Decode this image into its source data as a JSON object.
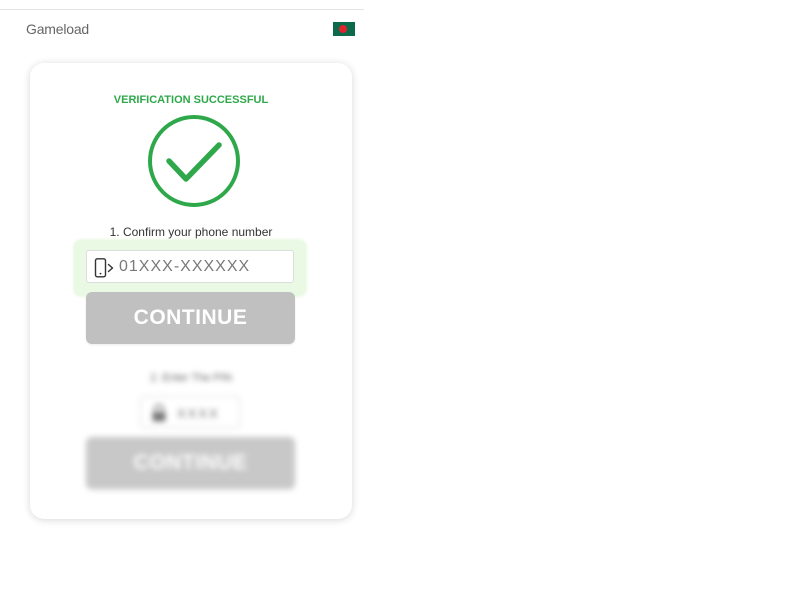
{
  "header": {
    "brand": "Gameload",
    "flag_icon": "bangladesh-flag-icon"
  },
  "status": {
    "text": "VERIFICATION SUCCESSFUL",
    "icon": "checkmark-circle-icon",
    "color": "#2ea84a"
  },
  "step1": {
    "label": "1. Confirm your phone number",
    "phone_icon": "mobile-phone-icon",
    "phone_placeholder": "01XXX-XXXXXX",
    "phone_value": "",
    "button_label": "CONTINUE"
  },
  "step2": {
    "label": "2. Enter The PIN",
    "lock_icon": "lock-icon",
    "pin_placeholder": "XXXX",
    "pin_value": "",
    "button_label": "CONTINUE"
  },
  "colors": {
    "accent_green": "#2ea84a",
    "button_disabled": "#c0c0c0",
    "highlight_bg": "#e9f9e4"
  }
}
